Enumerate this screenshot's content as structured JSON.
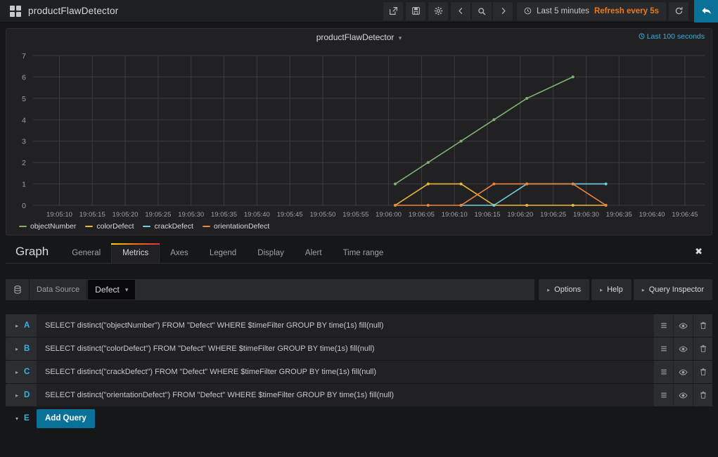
{
  "topnav": {
    "brand_title": "productFlawDetector",
    "buttons": [
      {
        "name": "share-dashboard-button",
        "icon": "share-icon"
      },
      {
        "name": "save-dashboard-button",
        "icon": "save-icon"
      },
      {
        "name": "dashboard-settings-button",
        "icon": "gear-icon"
      }
    ],
    "time_nav": [
      {
        "name": "time-shift-back-button",
        "icon": "chevron-left-icon"
      },
      {
        "name": "zoom-out-button",
        "icon": "magnifier-icon"
      },
      {
        "name": "time-shift-forward-button",
        "icon": "chevron-right-icon"
      }
    ],
    "time_range_label": "Last 5 minutes",
    "refresh_label": "Refresh every 5s",
    "refresh_button_icon": "refresh-icon",
    "back_button_icon": "back-arrow-icon"
  },
  "panel": {
    "title": "productFlawDetector",
    "title_caret": "▾",
    "time_info": "Last 100 seconds",
    "time_info_icon": "clock-icon"
  },
  "chart_data": {
    "type": "line",
    "title": "productFlawDetector",
    "xlabel": "",
    "ylabel": "",
    "ylim": [
      0,
      7
    ],
    "yticks": [
      0,
      1,
      2,
      3,
      4,
      5,
      6,
      7
    ],
    "xticks": [
      "19:05:10",
      "19:05:15",
      "19:05:20",
      "19:05:25",
      "19:05:30",
      "19:05:35",
      "19:05:40",
      "19:05:45",
      "19:05:50",
      "19:05:55",
      "19:06:00",
      "19:06:05",
      "19:06:10",
      "19:06:15",
      "19:06:20",
      "19:06:25",
      "19:06:30",
      "19:06:35",
      "19:06:40",
      "19:06:45"
    ],
    "xlim": [
      "19:05:06",
      "19:06:48"
    ],
    "grid": true,
    "legend_position": "bottom-left",
    "x": [
      "19:06:01",
      "19:06:06",
      "19:06:11",
      "19:06:16",
      "19:06:21",
      "19:06:28",
      "19:06:33"
    ],
    "series": [
      {
        "name": "objectNumber",
        "color": "#7eb26d",
        "values": [
          1,
          2,
          3,
          4,
          5,
          6,
          null
        ]
      },
      {
        "name": "colorDefect",
        "color": "#eab839",
        "values": [
          0,
          1,
          1,
          0,
          0,
          0,
          0
        ]
      },
      {
        "name": "crackDefect",
        "color": "#6ed0e0",
        "values": [
          null,
          null,
          0,
          0,
          1,
          1,
          1
        ]
      },
      {
        "name": "orientationDefect",
        "color": "#ef843c",
        "values": [
          0,
          0,
          0,
          1,
          1,
          1,
          0
        ]
      }
    ]
  },
  "editor": {
    "name": "Graph",
    "tabs": [
      {
        "label": "General",
        "active": false
      },
      {
        "label": "Metrics",
        "active": true
      },
      {
        "label": "Axes",
        "active": false
      },
      {
        "label": "Legend",
        "active": false
      },
      {
        "label": "Display",
        "active": false
      },
      {
        "label": "Alert",
        "active": false
      },
      {
        "label": "Time range",
        "active": false
      }
    ],
    "close_label": "✖",
    "datasource": {
      "icon": "database-icon",
      "label": "Data Source",
      "value": "Defect",
      "caret": "▾"
    },
    "right_buttons": [
      {
        "label": "Options",
        "tri": "▸"
      },
      {
        "label": "Help",
        "tri": "▸"
      },
      {
        "label": "Query Inspector",
        "tri": "▸"
      }
    ],
    "queries": [
      {
        "letter": "A",
        "caret": "▸",
        "text": "SELECT distinct(\"objectNumber\") FROM \"Defect\" WHERE $timeFilter GROUP BY time(1s) fill(null)"
      },
      {
        "letter": "B",
        "caret": "▸",
        "text": "SELECT distinct(\"colorDefect\") FROM \"Defect\" WHERE $timeFilter GROUP BY time(1s) fill(null)"
      },
      {
        "letter": "C",
        "caret": "▸",
        "text": "SELECT distinct(\"crackDefect\") FROM \"Defect\" WHERE $timeFilter GROUP BY time(1s) fill(null)"
      },
      {
        "letter": "D",
        "caret": "▸",
        "text": "SELECT distinct(\"orientationDefect\") FROM \"Defect\" WHERE $timeFilter GROUP BY time(1s) fill(null)"
      }
    ],
    "row_actions": [
      {
        "name": "query-toggle-editor-icon",
        "icon": "list-icon"
      },
      {
        "name": "query-visibility-icon",
        "icon": "eye-icon"
      },
      {
        "name": "query-delete-icon",
        "icon": "trash-icon"
      }
    ],
    "add_query": {
      "letter": "E",
      "caret": "▾",
      "label": "Add Query"
    }
  }
}
